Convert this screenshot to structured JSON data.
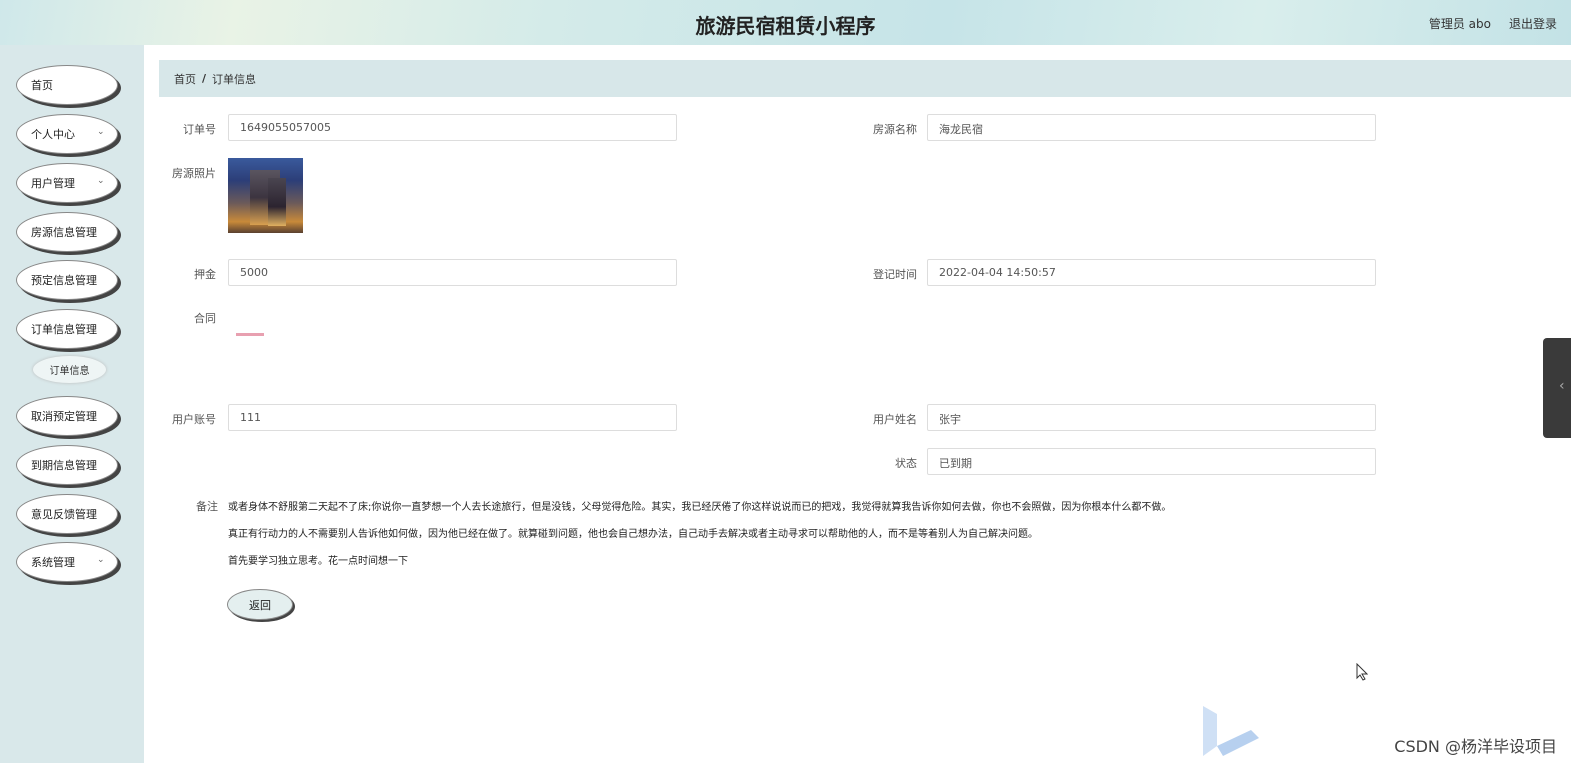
{
  "header": {
    "title": "旅游民宿租赁小程序",
    "user": "管理员 abo",
    "logout": "退出登录"
  },
  "sidebar": {
    "items": [
      {
        "label": "首页",
        "has_chevron": false
      },
      {
        "label": "个人中心",
        "has_chevron": true
      },
      {
        "label": "用户管理",
        "has_chevron": true
      },
      {
        "label": "房源信息管理",
        "has_chevron": false
      },
      {
        "label": "预定信息管理",
        "has_chevron": false
      },
      {
        "label": "订单信息管理",
        "has_chevron": false
      },
      {
        "label": "取消预定管理",
        "has_chevron": false
      },
      {
        "label": "到期信息管理",
        "has_chevron": false
      },
      {
        "label": "意见反馈管理",
        "has_chevron": false
      },
      {
        "label": "系统管理",
        "has_chevron": true
      }
    ],
    "submenu": {
      "label": "订单信息"
    }
  },
  "breadcrumb": {
    "home": "首页",
    "separator": "/",
    "current": "订单信息"
  },
  "form": {
    "order_no": {
      "label": "订单号",
      "value": "1649055057005"
    },
    "room_name": {
      "label": "房源名称",
      "value": "海龙民宿"
    },
    "room_photo": {
      "label": "房源照片"
    },
    "deposit": {
      "label": "押金",
      "value": "5000"
    },
    "register_time": {
      "label": "登记时间",
      "value": "2022-04-04 14:50:57"
    },
    "contract": {
      "label": "合同"
    },
    "user_account": {
      "label": "用户账号",
      "value": "111"
    },
    "user_name": {
      "label": "用户姓名",
      "value": "张宇"
    },
    "status": {
      "label": "状态",
      "value": "已到期"
    },
    "notes": {
      "label": "备注",
      "lines": [
        "或者身体不舒服第二天起不了床;你说你一直梦想一个人去长途旅行，但是没钱，父母觉得危险。其实，我已经厌倦了你这样说说而已的把戏，我觉得就算我告诉你如何去做，你也不会照做，因为你根本什么都不做。",
        "真正有行动力的人不需要别人告诉他如何做，因为他已经在做了。就算碰到问题，他也会自己想办法，自己动手去解决或者主动寻求可以帮助他的人，而不是等着别人为自己解决问题。",
        "首先要学习独立思考。花一点时间想一下"
      ]
    }
  },
  "buttons": {
    "back": "返回"
  },
  "watermark": "CSDN @杨洋毕设项目"
}
